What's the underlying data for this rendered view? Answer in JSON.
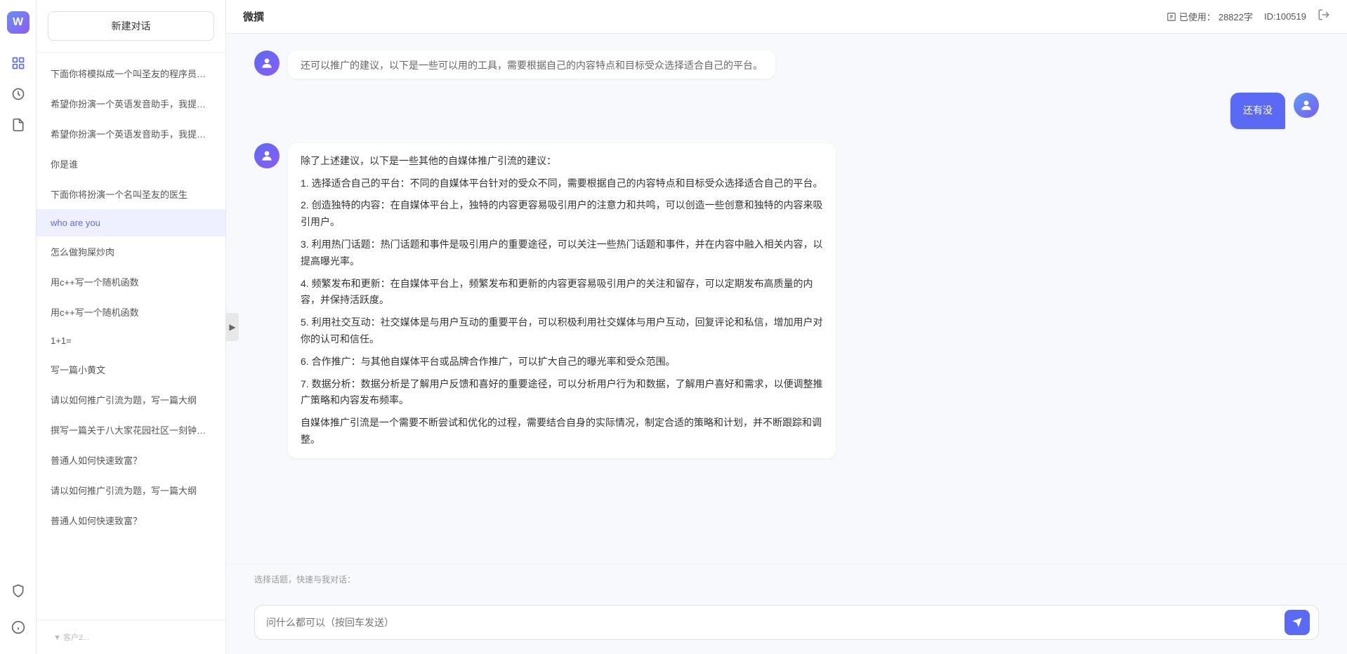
{
  "app": {
    "title": "微撰",
    "usage_label": "已使用：",
    "usage_value": "28822字",
    "user_id_label": "ID:100519"
  },
  "sidebar": {
    "new_chat": "新建对话",
    "items": [
      {
        "id": "item1",
        "label": "下面你将模拟成一个叫圣友的程序员，我说...",
        "active": false
      },
      {
        "id": "item2",
        "label": "希望你扮演一个英语发音助手，我提供给你...",
        "active": false
      },
      {
        "id": "item3",
        "label": "希望你扮演一个英语发音助手，我提供给你...",
        "active": false
      },
      {
        "id": "item4",
        "label": "你是谁",
        "active": false
      },
      {
        "id": "item5",
        "label": "下面你将扮演一个名叫圣友的医生",
        "active": false
      },
      {
        "id": "item6",
        "label": "who are you",
        "active": true
      },
      {
        "id": "item7",
        "label": "怎么做狗屎炒肉",
        "active": false
      },
      {
        "id": "item8",
        "label": "用c++写一个随机函数",
        "active": false
      },
      {
        "id": "item9",
        "label": "用c++写一个随机函数",
        "active": false
      },
      {
        "id": "item10",
        "label": "1+1=",
        "active": false
      },
      {
        "id": "item11",
        "label": "写一篇小黄文",
        "active": false
      },
      {
        "id": "item12",
        "label": "请以如何推广引流为题，写一篇大纲",
        "active": false
      },
      {
        "id": "item13",
        "label": "撰写一篇关于八大家花园社区一刻钟便民生...",
        "active": false
      },
      {
        "id": "item14",
        "label": "普通人如何快速致富？",
        "active": false
      },
      {
        "id": "item15",
        "label": "请以如何推广引流为题，写一篇大纲",
        "active": false
      },
      {
        "id": "item16",
        "label": "普通人如何快速致富？",
        "active": false
      }
    ]
  },
  "chat": {
    "partial_top_text": "还可以推广的建议，以下是一些可以用的工具，需要根据自己的内容特点和目标受众选择适合自己的平台。",
    "user_message": "还有没",
    "ai_response": {
      "intro": "除了上述建议，以下是一些其他的自媒体推广引流的建议：",
      "points": [
        "1. 选择适合自己的平台：不同的自媒体平台针对的受众不同，需要根据自己的内容特点和目标受众选择适合自己的平台。",
        "2. 创造独特的内容：在自媒体平台上，独特的内容更容易吸引用户的注意力和共鸣，可以创造一些创意和独特的内容来吸引用户。",
        "3. 利用热门话题：热门话题和事件是吸引用户的重要途径，可以关注一些热门话题和事件，并在内容中融入相关内容，以提高曝光率。",
        "4. 频繁发布和更新：在自媒体平台上，频繁发布和更新的内容更容易吸引用户的关注和留存，可以定期发布高质量的内容，并保持活跃度。",
        "5. 利用社交互动：社交媒体是与用户互动的重要平台，可以积极利用社交媒体与用户互动，回复评论和私信，增加用户对你的认可和信任。",
        "6. 合作推广：与其他自媒体平台或品牌合作推广，可以扩大自己的曝光率和受众范围。",
        "7. 数据分析：数据分析是了解用户反馈和喜好的重要途径，可以分析用户行为和数据，了解用户喜好和需求，以便调整推广策略和内容发布频率。"
      ],
      "conclusion": "自媒体推广引流是一个需要不断尝试和优化的过程，需要结合自身的实际情况，制定合适的策略和计划，并不断跟踪和调整。"
    }
  },
  "input": {
    "placeholder": "问什么都可以（按回车发送）",
    "quick_label": "选择话题，快速与我对话："
  },
  "icons": {
    "send": "➤",
    "toggle": "▶",
    "logo": "W",
    "power": "⏻",
    "shield": "🛡",
    "clock": "⏰",
    "file": "📄",
    "info": "ⓘ",
    "lock": "🔒"
  }
}
